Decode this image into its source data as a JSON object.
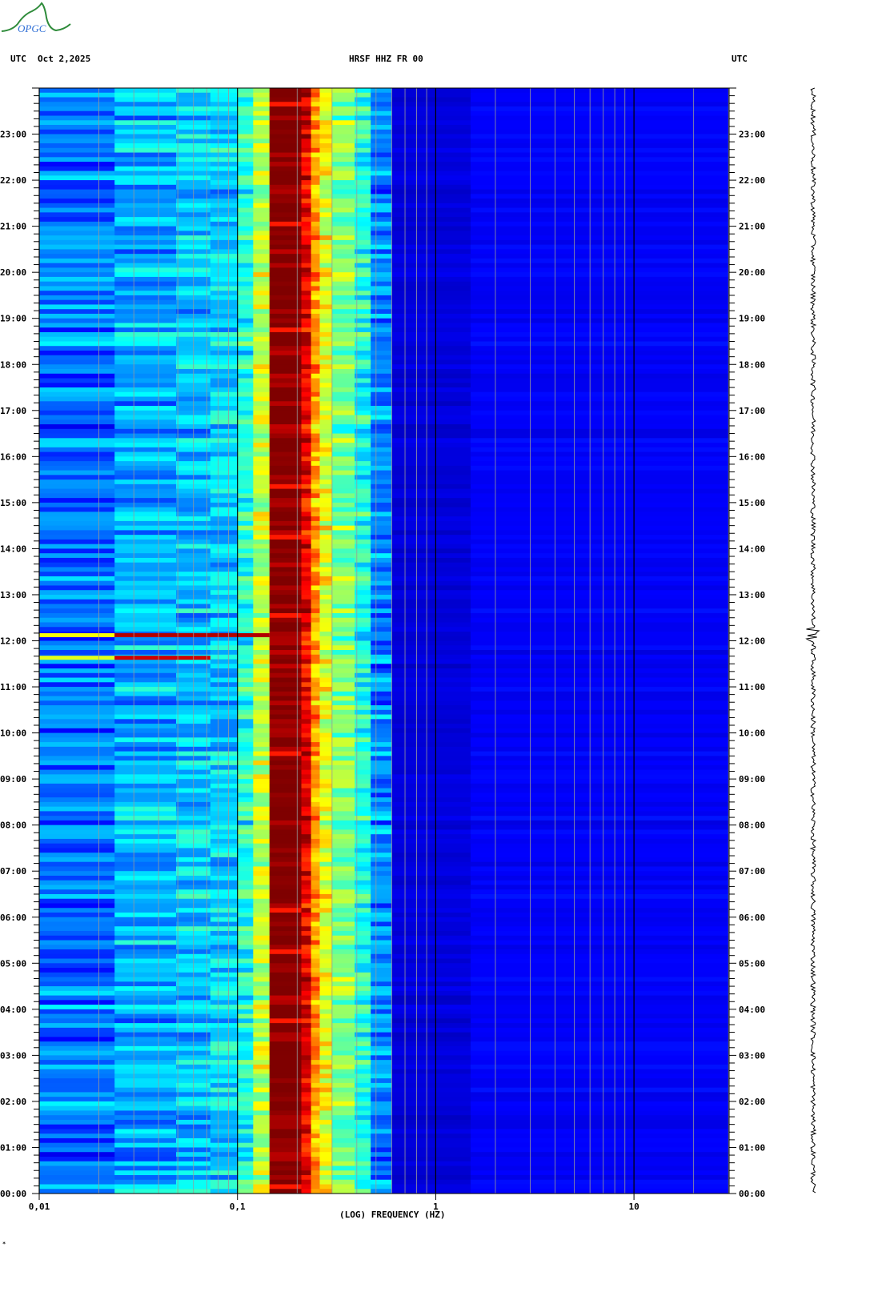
{
  "logo": {
    "text": "OPGC",
    "colors": {
      "mountain": "#2e8b3a",
      "text": "#2f6fd6"
    }
  },
  "header": {
    "tz_left": "UTC",
    "date": "Oct 2,2025",
    "station": "HRSF HHZ FR 00",
    "tz_right": "UTC"
  },
  "footer_mark": "*",
  "chart_data": {
    "type": "heatmap",
    "title": "HRSF HHZ FR 00",
    "subtitle": "Oct 2,2025",
    "xlabel": "(LOG) FREQUENCY (HZ)",
    "ylabel": "UTC",
    "xscale": "log",
    "xlim": [
      0.01,
      30
    ],
    "ylim_hours": [
      0,
      24
    ],
    "colormap": "jet",
    "x_ticks": [
      {
        "value": 0.01,
        "label": "0,01"
      },
      {
        "value": 0.1,
        "label": "0,1"
      },
      {
        "value": 1,
        "label": "1"
      },
      {
        "value": 10,
        "label": "10"
      }
    ],
    "y_ticks": [
      "00:00",
      "01:00",
      "02:00",
      "03:00",
      "04:00",
      "05:00",
      "06:00",
      "07:00",
      "08:00",
      "09:00",
      "10:00",
      "11:00",
      "12:00",
      "13:00",
      "14:00",
      "15:00",
      "16:00",
      "17:00",
      "18:00",
      "19:00",
      "20:00",
      "21:00",
      "22:00",
      "23:00"
    ],
    "minor_tick_minutes": 10,
    "bands": [
      {
        "f0": 0.01,
        "f1": 0.024,
        "level": 0.24
      },
      {
        "f0": 0.024,
        "f1": 0.049,
        "level": 0.3
      },
      {
        "f0": 0.049,
        "f1": 0.073,
        "level": 0.32
      },
      {
        "f0": 0.073,
        "f1": 0.1,
        "level": 0.34
      },
      {
        "f0": 0.1,
        "f1": 0.12,
        "level": 0.4
      },
      {
        "f0": 0.12,
        "f1": 0.145,
        "level": 0.56
      },
      {
        "f0": 0.145,
        "f1": 0.21,
        "level": 1.0
      },
      {
        "f0": 0.21,
        "f1": 0.235,
        "level": 0.9
      },
      {
        "f0": 0.235,
        "f1": 0.26,
        "level": 0.72
      },
      {
        "f0": 0.26,
        "f1": 0.3,
        "level": 0.6
      },
      {
        "f0": 0.3,
        "f1": 0.39,
        "level": 0.5
      },
      {
        "f0": 0.39,
        "f1": 0.47,
        "level": 0.4
      },
      {
        "f0": 0.47,
        "f1": 0.6,
        "level": 0.26
      },
      {
        "f0": 0.6,
        "f1": 1.5,
        "level": 0.09
      },
      {
        "f0": 1.5,
        "f1": 30,
        "level": 0.12
      }
    ],
    "events": [
      {
        "time_hours": 12.13,
        "f0": 0.01,
        "f1": 0.024,
        "level": 0.62
      },
      {
        "time_hours": 12.13,
        "f0": 0.024,
        "f1": 0.145,
        "level": 0.95
      },
      {
        "time_hours": 11.64,
        "f0": 0.01,
        "f1": 0.024,
        "level": 0.6
      },
      {
        "time_hours": 11.64,
        "f0": 0.024,
        "f1": 0.073,
        "level": 0.92
      }
    ],
    "seismogram": {
      "event_time_hours": 12.0
    }
  }
}
